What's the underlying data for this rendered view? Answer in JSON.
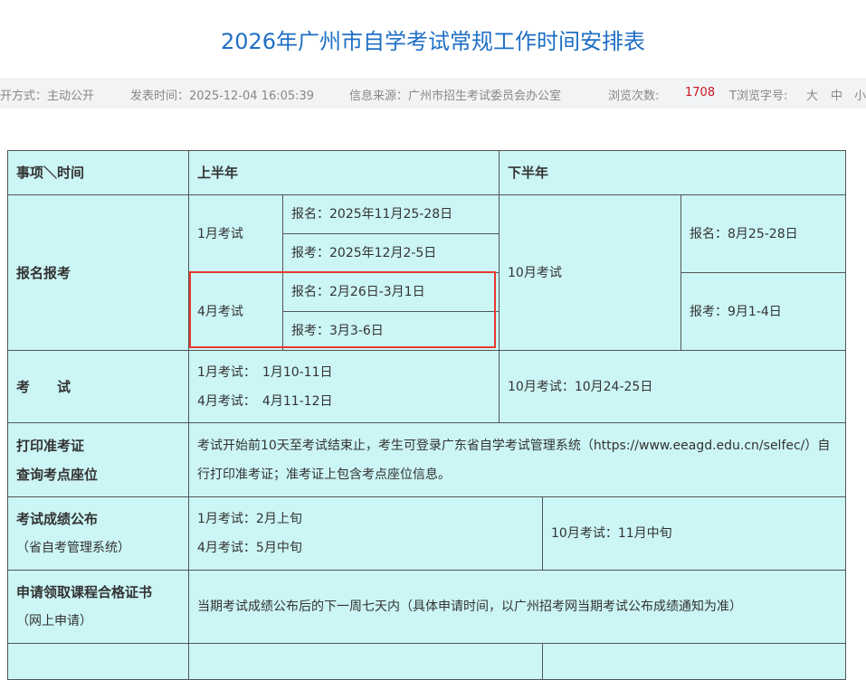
{
  "page": {
    "title": "2026年广州市自学考试常规工作时间安排表"
  },
  "meta": {
    "open_mode": "开方式：主动公开",
    "publish_time": "发表时间：2025-12-04 16:05:39",
    "source": "信息来源：广州市招生考试委员会办公室",
    "views_label": "浏览次数:",
    "views_count": "1708",
    "font_size_label": "T浏览字号:",
    "font_large": "大",
    "font_medium": "中",
    "font_small": "小"
  },
  "table": {
    "header": {
      "item": "事项＼时间",
      "first_half": "上半年",
      "second_half": "下半年"
    },
    "registration": {
      "label": "报名报考",
      "jan_exam": "1月考试",
      "jan_signup": "报名：2025年11月25-28日",
      "jan_apply": "报考：2025年12月2-5日",
      "apr_exam": "4月考试",
      "apr_signup": "报名：2月26日-3月1日",
      "apr_apply": "报考：3月3-6日",
      "oct_exam": "10月考试",
      "oct_signup": "报名：8月25-28日",
      "oct_apply": "报考：9月1-4日"
    },
    "exam": {
      "label": "考　　试",
      "jan": "1月考试：　1月10-11日",
      "apr": "4月考试：　4月11-12日",
      "oct": "10月考试：10月24-25日"
    },
    "admission": {
      "label_line1": "打印准考证",
      "label_line2": "查询考点座位",
      "text": "考试开始前10天至考试结束止，考生可登录广东省自学考试管理系统（https://www.eeagd.edu.cn/selfec/）自行打印准考证；准考证上包含考点座位信息。"
    },
    "results": {
      "label": "考试成绩公布",
      "sub": "（省自考管理系统）",
      "jan": "1月考试：2月上旬",
      "apr": "4月考试：5月中旬",
      "oct": "10月考试：11月中旬"
    },
    "certificate": {
      "label": "申请领取课程合格证书",
      "sub": "（网上申请）",
      "text": "当期考试成绩公布后的下一周七天内（具体申请时间，以广州招考网当期考试公布成绩通知为准）"
    }
  }
}
